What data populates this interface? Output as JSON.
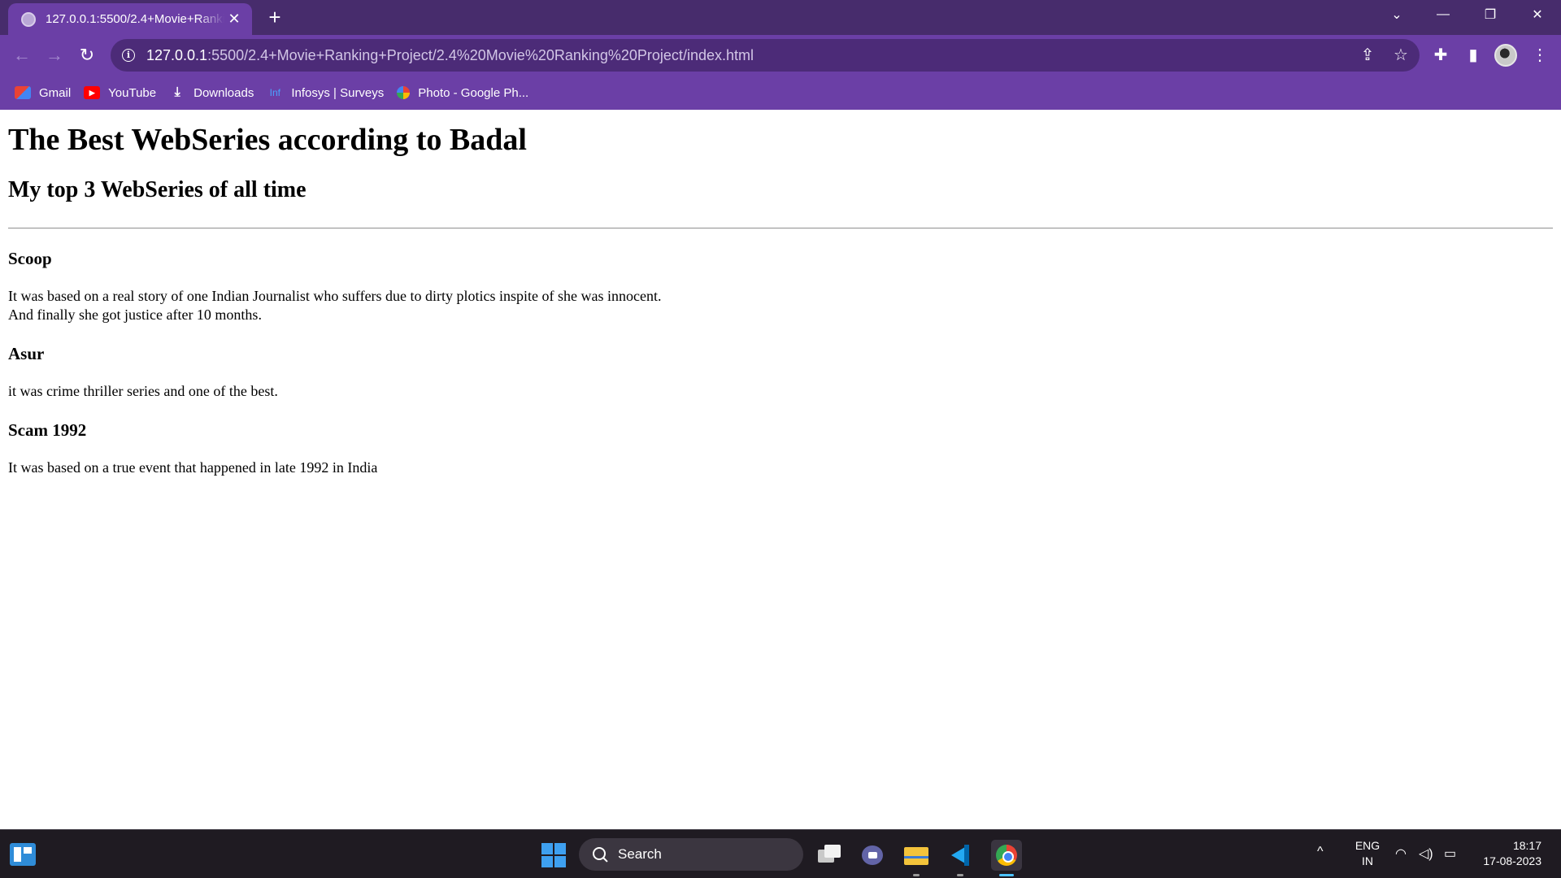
{
  "browser": {
    "tab_title": "127.0.0.1:5500/2.4+Movie+Ranking+Project/2.4%20Movie%20Ranking%20Project/index.html",
    "tab_close": "✕",
    "new_tab": "+",
    "url_host": "127.0.0.1",
    "url_rest": ":5500/2.4+Movie+Ranking+Project/2.4%20Movie%20Ranking%20Project/index.html",
    "bookmarks": [
      "Gmail",
      "YouTube",
      "Downloads",
      "Infosys | Surveys",
      "Photo - Google Ph..."
    ],
    "infosys_icon_text": "Inf"
  },
  "page": {
    "title": "The Best WebSeries according to Badal",
    "subtitle": "My top 3 WebSeries of all time",
    "series": [
      {
        "name": "Scoop",
        "lines": [
          "It was based on a real story of one Indian Journalist who suffers due to dirty plotics inspite of she was innocent.",
          "And finally she got justice after 10 months."
        ]
      },
      {
        "name": "Asur",
        "lines": [
          "it was crime thriller series and one of the best."
        ]
      },
      {
        "name": "Scam 1992",
        "lines": [
          "It was based on a true event that happened in late 1992 in India"
        ]
      }
    ]
  },
  "taskbar": {
    "search_label": "Search",
    "lang_primary": "ENG",
    "lang_secondary": "IN",
    "time": "18:17",
    "date": "17-08-2023"
  },
  "colors": {
    "tab_strip": "#472c6c",
    "toolbar": "#6b3fa6",
    "omnibox": "#4c2b78",
    "taskbar": "#1f1b22"
  }
}
